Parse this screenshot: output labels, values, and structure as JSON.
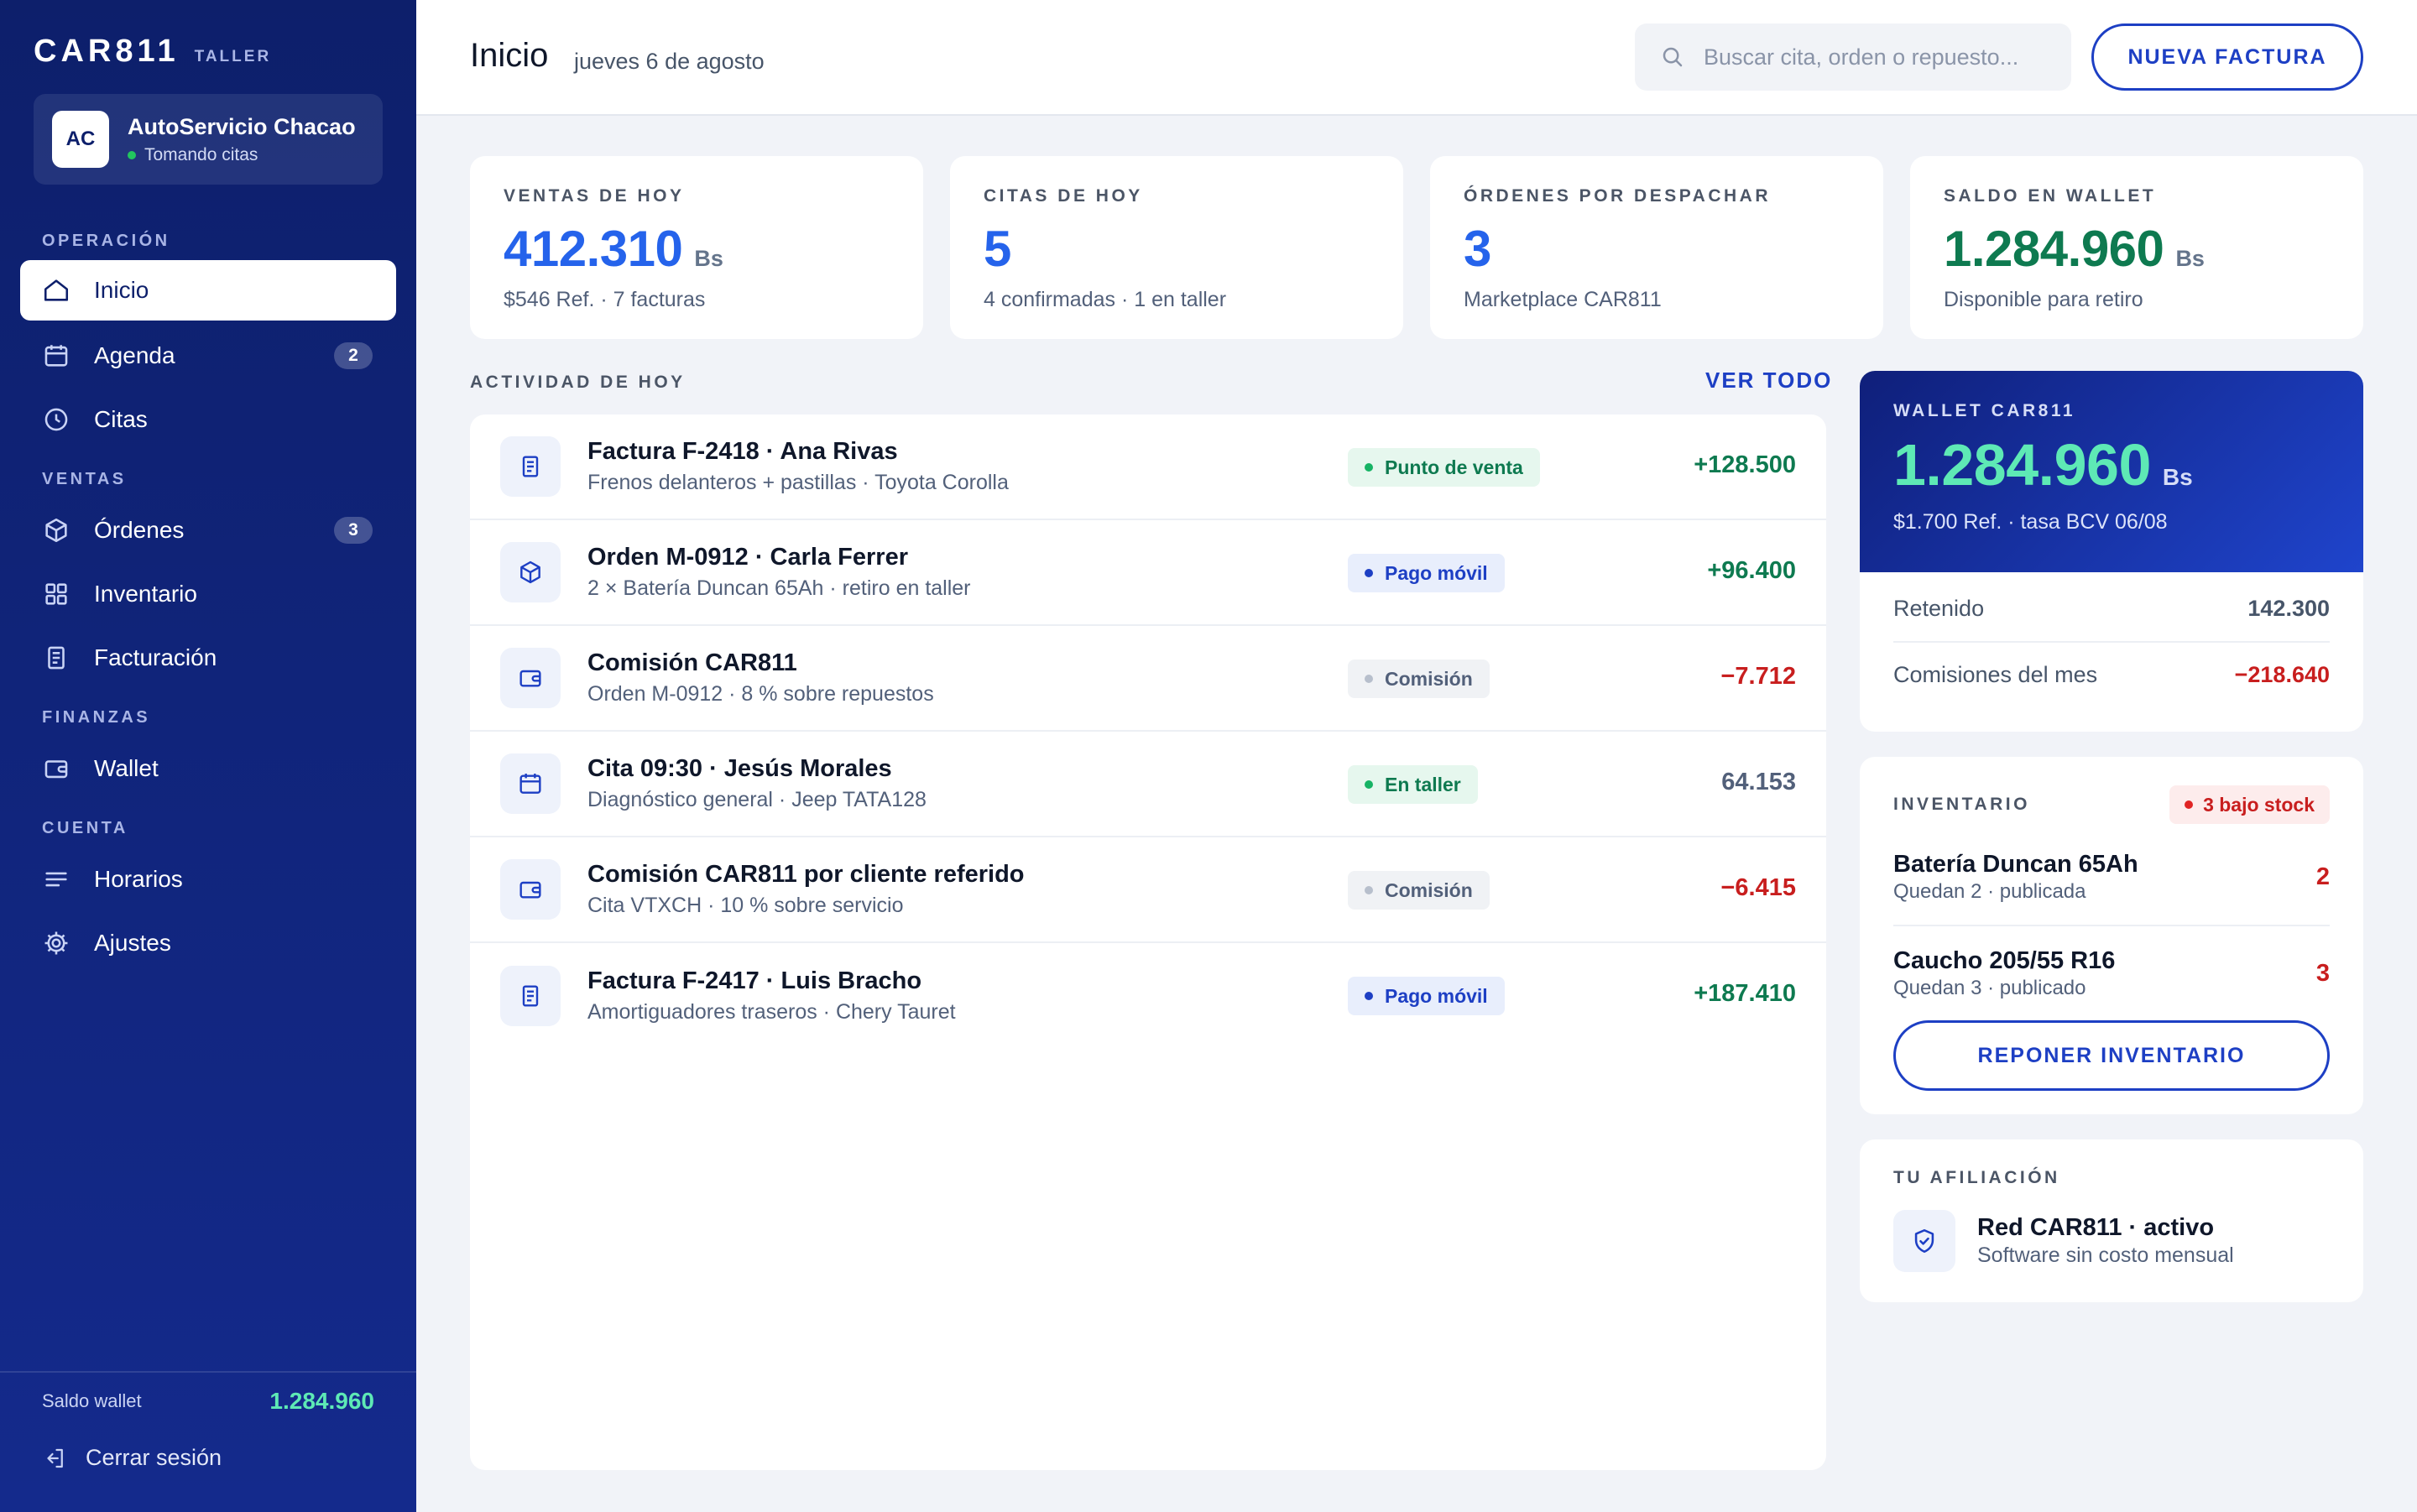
{
  "brand": {
    "name": "CAR811",
    "tag": "TALLER"
  },
  "shop": {
    "initials": "AC",
    "name": "AutoServicio Chacao",
    "status": "Tomando citas",
    "status_color": "#22c55e"
  },
  "nav": {
    "sections": {
      "operacion": "OPERACIÓN",
      "ventas": "VENTAS",
      "finanzas": "FINANZAS",
      "cuenta": "CUENTA"
    },
    "items": {
      "inicio": {
        "label": "Inicio",
        "icon": "home-icon",
        "active": true
      },
      "agenda": {
        "label": "Agenda",
        "icon": "calendar-icon",
        "badge": "2"
      },
      "citas": {
        "label": "Citas",
        "icon": "clock-icon"
      },
      "ordenes": {
        "label": "Órdenes",
        "icon": "box-icon",
        "badge": "3"
      },
      "inventario": {
        "label": "Inventario",
        "icon": "grid-icon"
      },
      "facturacion": {
        "label": "Facturación",
        "icon": "receipt-icon"
      },
      "wallet": {
        "label": "Wallet",
        "icon": "wallet-icon"
      },
      "horarios": {
        "label": "Horarios",
        "icon": "menu-lines-icon"
      },
      "ajustes": {
        "label": "Ajustes",
        "icon": "gear-icon"
      }
    }
  },
  "sidebar_footer": {
    "wallet_label": "Saldo wallet",
    "wallet_value": "1.284.960",
    "logout_label": "Cerrar sesión"
  },
  "topbar": {
    "title": "Inicio",
    "date": "jueves 6 de agosto",
    "search_placeholder": "Buscar cita, orden o repuesto...",
    "new_invoice_label": "NUEVA FACTURA"
  },
  "kpis": [
    {
      "label": "VENTAS DE HOY",
      "value": "412.310",
      "unit": "Bs",
      "sub": "$546 Ref. · 7 facturas",
      "color": "#2563eb"
    },
    {
      "label": "CITAS DE HOY",
      "value": "5",
      "unit": "",
      "sub": "4 confirmadas · 1 en taller",
      "color": "#2563eb"
    },
    {
      "label": "ÓRDENES POR DESPACHAR",
      "value": "3",
      "unit": "",
      "sub": "Marketplace CAR811",
      "color": "#2563eb"
    },
    {
      "label": "SALDO EN WALLET",
      "value": "1.284.960",
      "unit": "Bs",
      "sub": "Disponible para retiro",
      "color": "#0e7a50"
    }
  ],
  "activity": {
    "title": "ACTIVIDAD DE HOY",
    "see_all": "VER TODO",
    "rows": [
      {
        "icon": "receipt-icon",
        "title": "Factura F-2418 · Ana Rivas",
        "sub": "Frenos delanteros + pastillas · Toyota Corolla",
        "tag": "Punto de venta",
        "tag_style": "green",
        "amount": "+128.500",
        "amount_style": "pos"
      },
      {
        "icon": "box-icon",
        "title": "Orden M-0912 · Carla Ferrer",
        "sub": "2 × Batería Duncan 65Ah · retiro en taller",
        "tag": "Pago móvil",
        "tag_style": "blue",
        "amount": "+96.400",
        "amount_style": "pos"
      },
      {
        "icon": "wallet-icon",
        "title": "Comisión CAR811",
        "sub": "Orden M-0912 · 8 % sobre repuestos",
        "tag": "Comisión",
        "tag_style": "gray",
        "amount": "−7.712",
        "amount_style": "neg"
      },
      {
        "icon": "calendar-icon",
        "title": "Cita 09:30 · Jesús Morales",
        "sub": "Diagnóstico general · Jeep TATA128",
        "tag": "En taller",
        "tag_style": "green",
        "amount": "64.153",
        "amount_style": "neu"
      },
      {
        "icon": "wallet-icon",
        "title": "Comisión CAR811 por cliente referido",
        "sub": "Cita VTXCH · 10 % sobre servicio",
        "tag": "Comisión",
        "tag_style": "gray",
        "amount": "−6.415",
        "amount_style": "neg"
      },
      {
        "icon": "receipt-icon",
        "title": "Factura F-2417 · Luis Bracho",
        "sub": "Amortiguadores traseros · Chery Tauret",
        "tag": "Pago móvil",
        "tag_style": "blue",
        "amount": "+187.410",
        "amount_style": "pos"
      }
    ]
  },
  "wallet": {
    "label": "WALLET CAR811",
    "value": "1.284.960",
    "unit": "Bs",
    "sub": "$1.700 Ref. · tasa BCV 06/08",
    "retenido_label": "Retenido",
    "retenido_value": "142.300",
    "comisiones_label": "Comisiones del mes",
    "comisiones_value": "−218.640"
  },
  "inventory": {
    "label": "INVENTARIO",
    "alert": "3 bajo stock",
    "items": [
      {
        "name": "Batería Duncan 65Ah",
        "sub": "Quedan 2 · publicada",
        "count": "2"
      },
      {
        "name": "Caucho 205/55 R16",
        "sub": "Quedan 3 · publicado",
        "count": "3"
      }
    ],
    "button": "REPONER INVENTARIO"
  },
  "affiliation": {
    "label": "TU AFILIACIÓN",
    "title": "Red CAR811 · activo",
    "sub": "Software sin costo mensual",
    "icon": "shield-check-icon"
  }
}
